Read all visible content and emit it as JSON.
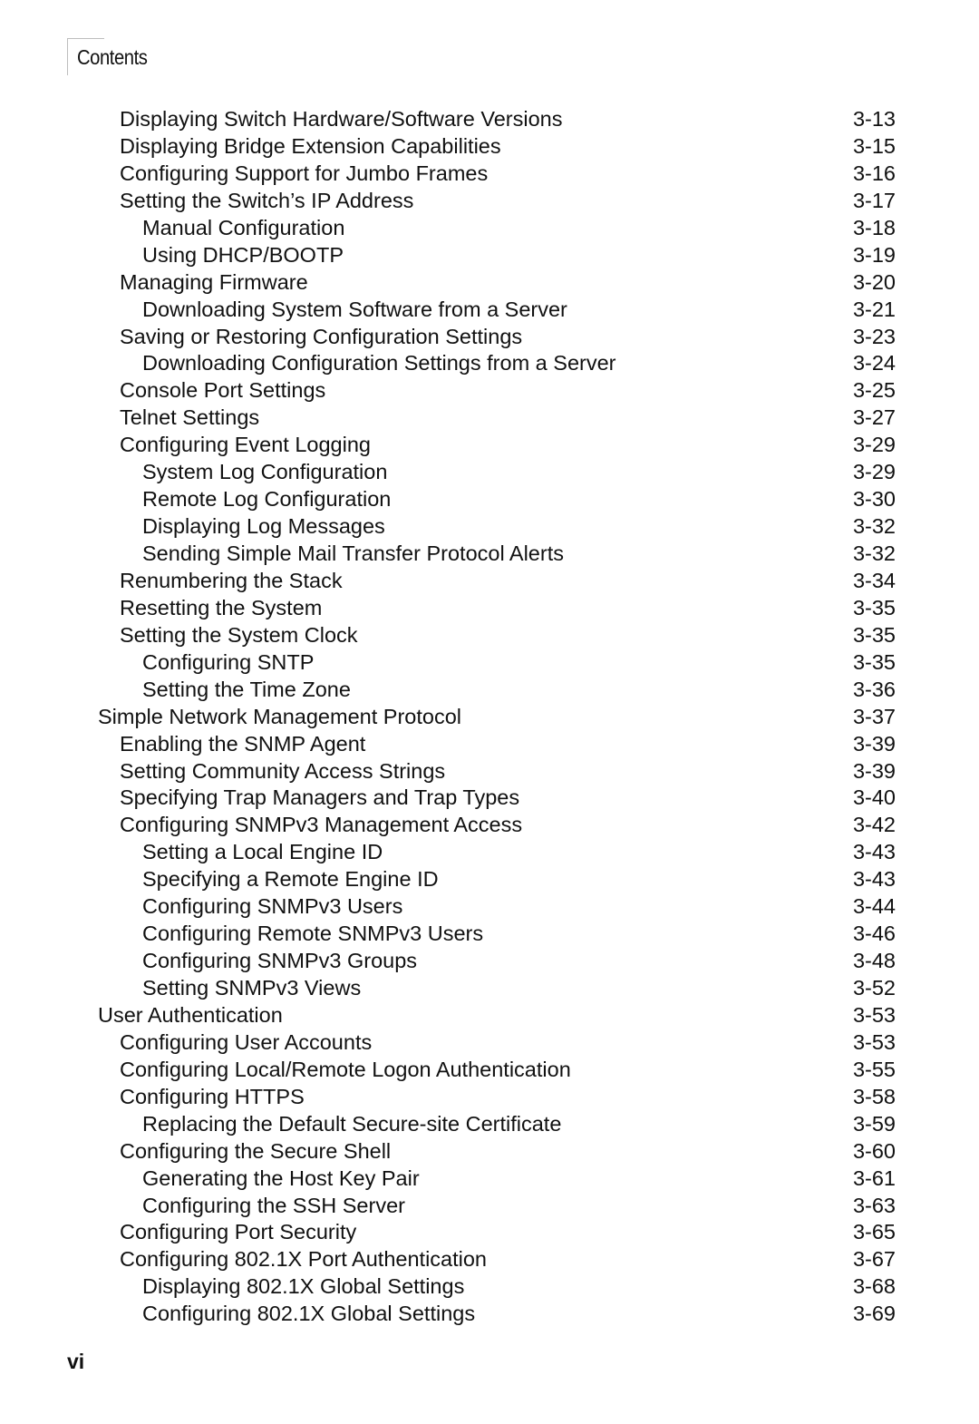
{
  "header": {
    "section_label": "Contents"
  },
  "toc": [
    {
      "level": 2,
      "title": "Displaying Switch Hardware/Software Versions",
      "page": "3-13"
    },
    {
      "level": 2,
      "title": "Displaying Bridge Extension Capabilities",
      "page": "3-15"
    },
    {
      "level": 2,
      "title": "Configuring Support for Jumbo Frames",
      "page": "3-16"
    },
    {
      "level": 2,
      "title": "Setting the Switch’s IP Address",
      "page": "3-17"
    },
    {
      "level": 3,
      "title": "Manual Configuration",
      "page": "3-18"
    },
    {
      "level": 3,
      "title": "Using DHCP/BOOTP",
      "page": "3-19"
    },
    {
      "level": 2,
      "title": "Managing Firmware",
      "page": "3-20"
    },
    {
      "level": 3,
      "title": "Downloading System Software from a Server",
      "page": "3-21"
    },
    {
      "level": 2,
      "title": "Saving or Restoring Configuration Settings",
      "page": "3-23"
    },
    {
      "level": 3,
      "title": "Downloading Configuration Settings from a Server",
      "page": "3-24"
    },
    {
      "level": 2,
      "title": "Console Port Settings",
      "page": "3-25"
    },
    {
      "level": 2,
      "title": "Telnet Settings",
      "page": "3-27"
    },
    {
      "level": 2,
      "title": "Configuring Event Logging",
      "page": "3-29"
    },
    {
      "level": 3,
      "title": "System Log Configuration",
      "page": "3-29"
    },
    {
      "level": 3,
      "title": "Remote Log Configuration",
      "page": "3-30"
    },
    {
      "level": 3,
      "title": "Displaying Log Messages",
      "page": "3-32"
    },
    {
      "level": 3,
      "title": "Sending Simple Mail Transfer Protocol Alerts",
      "page": "3-32"
    },
    {
      "level": 2,
      "title": "Renumbering the Stack",
      "page": "3-34"
    },
    {
      "level": 2,
      "title": "Resetting the System",
      "page": "3-35"
    },
    {
      "level": 2,
      "title": "Setting the System Clock",
      "page": "3-35"
    },
    {
      "level": 3,
      "title": "Configuring SNTP",
      "page": "3-35"
    },
    {
      "level": 3,
      "title": "Setting the Time Zone",
      "page": "3-36"
    },
    {
      "level": 1,
      "title": "Simple Network Management Protocol",
      "page": "3-37"
    },
    {
      "level": 2,
      "title": "Enabling the SNMP Agent",
      "page": "3-39"
    },
    {
      "level": 2,
      "title": "Setting Community Access Strings",
      "page": "3-39"
    },
    {
      "level": 2,
      "title": "Specifying Trap Managers and Trap Types",
      "page": "3-40"
    },
    {
      "level": 2,
      "title": "Configuring SNMPv3 Management Access",
      "page": "3-42"
    },
    {
      "level": 3,
      "title": "Setting a Local Engine ID",
      "page": "3-43"
    },
    {
      "level": 3,
      "title": "Specifying a Remote Engine ID",
      "page": "3-43"
    },
    {
      "level": 3,
      "title": "Configuring SNMPv3 Users",
      "page": "3-44"
    },
    {
      "level": 3,
      "title": "Configuring Remote SNMPv3 Users",
      "page": "3-46"
    },
    {
      "level": 3,
      "title": "Configuring SNMPv3 Groups",
      "page": "3-48"
    },
    {
      "level": 3,
      "title": "Setting SNMPv3 Views",
      "page": "3-52"
    },
    {
      "level": 1,
      "title": "User Authentication",
      "page": "3-53"
    },
    {
      "level": 2,
      "title": "Configuring User Accounts",
      "page": "3-53"
    },
    {
      "level": 2,
      "title": "Configuring Local/Remote Logon Authentication",
      "page": "3-55"
    },
    {
      "level": 2,
      "title": "Configuring HTTPS",
      "page": "3-58"
    },
    {
      "level": 3,
      "title": "Replacing the Default Secure-site Certificate",
      "page": "3-59"
    },
    {
      "level": 2,
      "title": "Configuring the Secure Shell",
      "page": "3-60"
    },
    {
      "level": 3,
      "title": "Generating the Host Key Pair",
      "page": "3-61"
    },
    {
      "level": 3,
      "title": "Configuring the SSH Server",
      "page": "3-63"
    },
    {
      "level": 2,
      "title": "Configuring Port Security",
      "page": "3-65"
    },
    {
      "level": 2,
      "title": "Configuring 802.1X Port Authentication",
      "page": "3-67"
    },
    {
      "level": 3,
      "title": "Displaying 802.1X Global Settings",
      "page": "3-68"
    },
    {
      "level": 3,
      "title": "Configuring 802.1X Global Settings",
      "page": "3-69"
    }
  ],
  "footer": {
    "page_number": "vi"
  }
}
